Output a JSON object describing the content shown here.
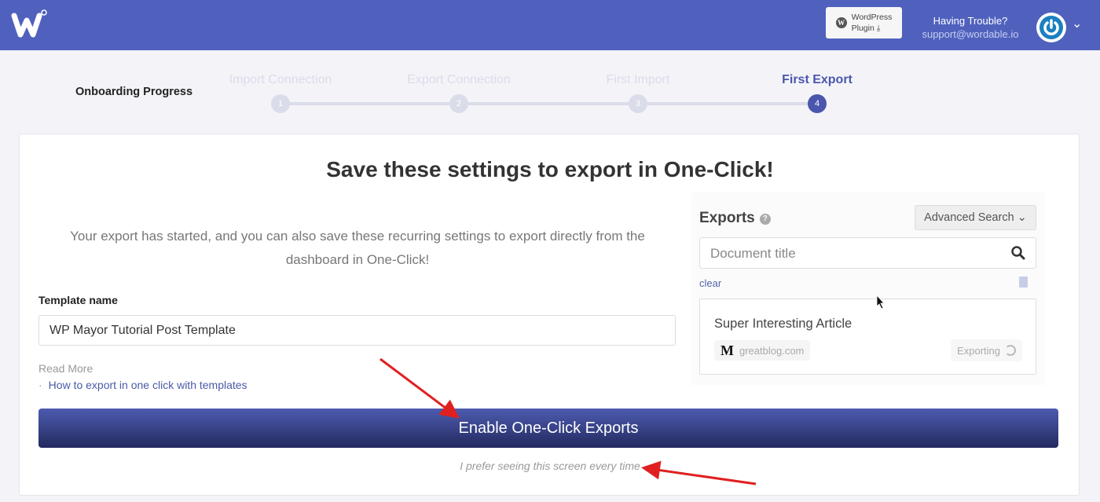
{
  "header": {
    "brand": "Wordable",
    "plugin_button": {
      "line1": "WordPress",
      "line2": "Plugin"
    },
    "help": {
      "title": "Having Trouble?",
      "email": "support@wordable.io"
    }
  },
  "progress": {
    "label": "Onboarding Progress",
    "steps": [
      {
        "label": "Import Connection",
        "number": "1"
      },
      {
        "label": "Export Connection",
        "number": "2"
      },
      {
        "label": "First Import",
        "number": "3"
      },
      {
        "label": "First Export",
        "number": "4",
        "active": true
      }
    ]
  },
  "main": {
    "title": "Save these settings to export in One-Click!",
    "description": "Your export has started, and you can also save these recurring settings to export directly from the dashboard in One-Click!",
    "template_label": "Template name",
    "template_value": "WP Mayor Tutorial Post Template",
    "read_more": "Read More",
    "read_more_link": "How to export in one click with templates",
    "enable_button": "Enable One-Click Exports",
    "prefer_link": "I prefer seeing this screen every time"
  },
  "exports_preview": {
    "title": "Exports",
    "advanced_search": "Advanced Search",
    "search_placeholder": "Document title",
    "clear": "clear",
    "item": {
      "title": "Super Interesting Article",
      "source_logo": "M",
      "source": "greatblog.com",
      "status": "Exporting"
    }
  },
  "colors": {
    "header": "#5061bd",
    "accent": "#4a57ad",
    "annotation": "#e02020"
  }
}
